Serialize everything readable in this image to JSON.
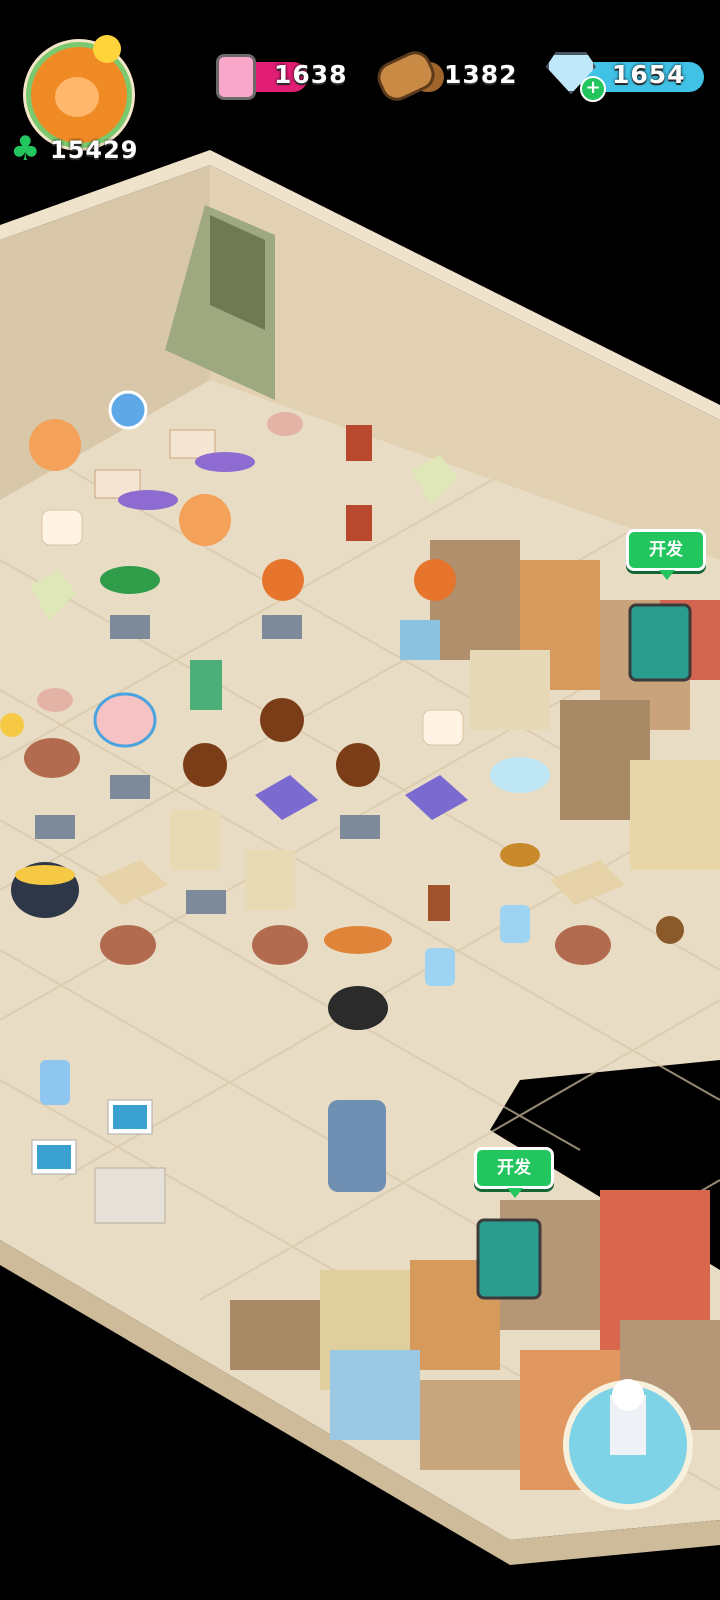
{
  "hud": {
    "clover_count": "15429",
    "jam_count": "1638",
    "wood_count": "1382",
    "gem_count": "1654"
  },
  "develop_buttons": [
    {
      "label": "开发"
    },
    {
      "label": "开发"
    }
  ],
  "colors": {
    "jam": "#e11d74",
    "wood": "#a0652b",
    "gem": "#3fc2e6",
    "clover": "#22c55e",
    "floor": "#e9dcc4",
    "wall": "#d8c7a8"
  }
}
